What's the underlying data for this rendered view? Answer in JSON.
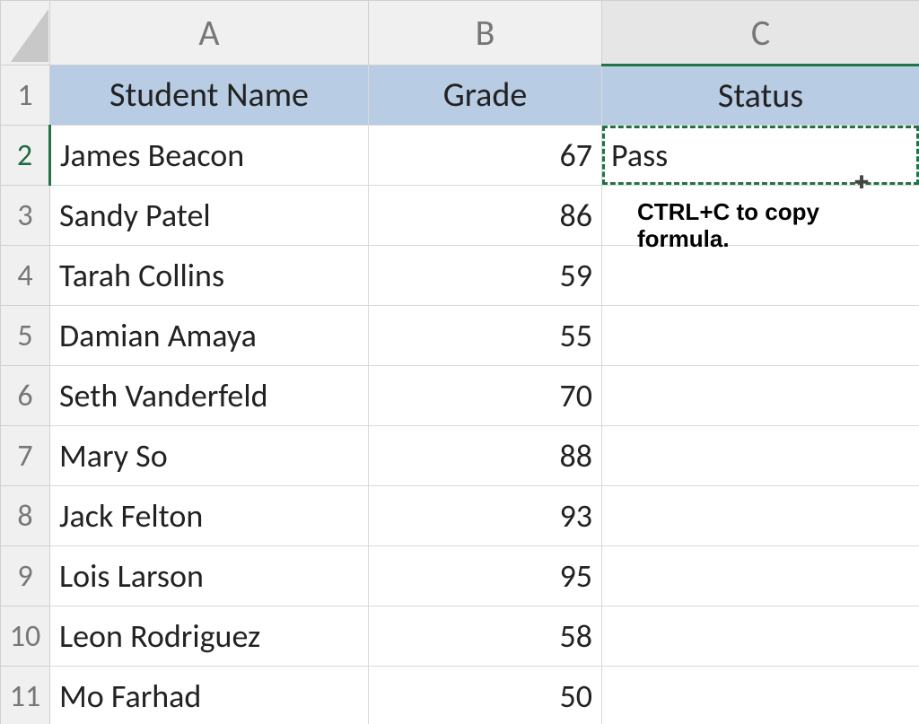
{
  "columns": {
    "A": "A",
    "B": "B",
    "C": "C"
  },
  "row_numbers": [
    "1",
    "2",
    "3",
    "4",
    "5",
    "6",
    "7",
    "8",
    "9",
    "10",
    "11"
  ],
  "header": {
    "name": "Student Name",
    "grade": "Grade",
    "status": "Status"
  },
  "rows": [
    {
      "name": "James Beacon",
      "grade": "67",
      "status": "Pass"
    },
    {
      "name": "Sandy Patel",
      "grade": "86",
      "status": ""
    },
    {
      "name": "Tarah Collins",
      "grade": "59",
      "status": ""
    },
    {
      "name": "Damian Amaya",
      "grade": "55",
      "status": ""
    },
    {
      "name": "Seth Vanderfeld",
      "grade": "70",
      "status": ""
    },
    {
      "name": "Mary So",
      "grade": "88",
      "status": ""
    },
    {
      "name": "Jack Felton",
      "grade": "93",
      "status": ""
    },
    {
      "name": "Lois Larson",
      "grade": "95",
      "status": ""
    },
    {
      "name": "Leon Rodriguez",
      "grade": "58",
      "status": ""
    },
    {
      "name": "Mo Farhad",
      "grade": "50",
      "status": ""
    }
  ],
  "annotation": "CTRL+C to copy formula.",
  "selection": {
    "copied_cell": "C2",
    "active_row": "2",
    "active_col": "C"
  },
  "colors": {
    "header_fill": "#b8cce4",
    "selection_border": "#217346"
  }
}
